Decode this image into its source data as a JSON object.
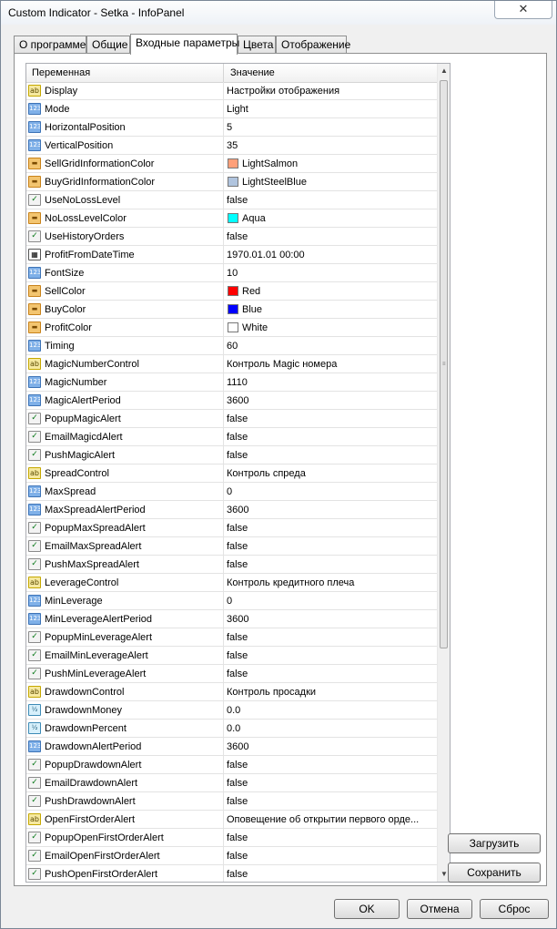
{
  "window": {
    "title": "Custom Indicator - Setka - InfoPanel",
    "close_glyph": "✕"
  },
  "tabs": [
    {
      "label": "О программе"
    },
    {
      "label": "Общие"
    },
    {
      "label": "Входные параметры"
    },
    {
      "label": "Цвета"
    },
    {
      "label": "Отображение"
    }
  ],
  "grid": {
    "col_variable": "Переменная",
    "col_value": "Значение",
    "rows": [
      {
        "type": "ab",
        "icon_text": "ab",
        "name": "Display",
        "value": "Настройки отображения"
      },
      {
        "type": "num",
        "icon_text": "123",
        "name": "Mode",
        "value": "Light"
      },
      {
        "type": "num",
        "icon_text": "123",
        "name": "HorizontalPosition",
        "value": "5"
      },
      {
        "type": "num",
        "icon_text": "123",
        "name": "VerticalPosition",
        "value": "35"
      },
      {
        "type": "color",
        "icon_text": "▬",
        "name": "SellGridInformationColor",
        "value": "LightSalmon",
        "swatch": "#ffa07a"
      },
      {
        "type": "color",
        "icon_text": "▬",
        "name": "BuyGridInformationColor",
        "value": "LightSteelBlue",
        "swatch": "#b0c4de"
      },
      {
        "type": "bool",
        "icon_text": "✓",
        "name": "UseNoLossLevel",
        "value": "false"
      },
      {
        "type": "color",
        "icon_text": "▬",
        "name": "NoLossLevelColor",
        "value": "Aqua",
        "swatch": "#00ffff"
      },
      {
        "type": "bool",
        "icon_text": "✓",
        "name": "UseHistoryOrders",
        "value": "false"
      },
      {
        "type": "dt",
        "icon_text": "▦",
        "name": "ProfitFromDateTime",
        "value": "1970.01.01 00:00"
      },
      {
        "type": "num",
        "icon_text": "123",
        "name": "FontSize",
        "value": "10"
      },
      {
        "type": "color",
        "icon_text": "▬",
        "name": "SellColor",
        "value": "Red",
        "swatch": "#ff0000"
      },
      {
        "type": "color",
        "icon_text": "▬",
        "name": "BuyColor",
        "value": "Blue",
        "swatch": "#0000ff"
      },
      {
        "type": "color",
        "icon_text": "▬",
        "name": "ProfitColor",
        "value": "White",
        "swatch": "#ffffff"
      },
      {
        "type": "num",
        "icon_text": "123",
        "name": "Timing",
        "value": "60"
      },
      {
        "type": "ab",
        "icon_text": "ab",
        "name": "MagicNumberControl",
        "value": "Контроль Magic номера"
      },
      {
        "type": "num",
        "icon_text": "123",
        "name": "MagicNumber",
        "value": "1110"
      },
      {
        "type": "num",
        "icon_text": "123",
        "name": "MagicAlertPeriod",
        "value": "3600"
      },
      {
        "type": "bool",
        "icon_text": "✓",
        "name": "PopupMagicAlert",
        "value": "false"
      },
      {
        "type": "bool",
        "icon_text": "✓",
        "name": "EmailMagicdAlert",
        "value": "false"
      },
      {
        "type": "bool",
        "icon_text": "✓",
        "name": "PushMagicAlert",
        "value": "false"
      },
      {
        "type": "ab",
        "icon_text": "ab",
        "name": "SpreadControl",
        "value": "Контроль спреда"
      },
      {
        "type": "num",
        "icon_text": "123",
        "name": "MaxSpread",
        "value": "0"
      },
      {
        "type": "num",
        "icon_text": "123",
        "name": "MaxSpreadAlertPeriod",
        "value": "3600"
      },
      {
        "type": "bool",
        "icon_text": "✓",
        "name": "PopupMaxSpreadAlert",
        "value": "false"
      },
      {
        "type": "bool",
        "icon_text": "✓",
        "name": "EmailMaxSpreadAlert",
        "value": "false"
      },
      {
        "type": "bool",
        "icon_text": "✓",
        "name": "PushMaxSpreadAlert",
        "value": "false"
      },
      {
        "type": "ab",
        "icon_text": "ab",
        "name": "LeverageControl",
        "value": "Контроль кредитного плеча"
      },
      {
        "type": "num",
        "icon_text": "123",
        "name": "MinLeverage",
        "value": "0"
      },
      {
        "type": "num",
        "icon_text": "123",
        "name": "MinLeverageAlertPeriod",
        "value": "3600"
      },
      {
        "type": "bool",
        "icon_text": "✓",
        "name": "PopupMinLeverageAlert",
        "value": "false"
      },
      {
        "type": "bool",
        "icon_text": "✓",
        "name": "EmailMinLeverageAlert",
        "value": "false"
      },
      {
        "type": "bool",
        "icon_text": "✓",
        "name": "PushMinLeverageAlert",
        "value": "false"
      },
      {
        "type": "ab",
        "icon_text": "ab",
        "name": "DrawdownControl",
        "value": "Контроль просадки"
      },
      {
        "type": "dbl",
        "icon_text": "½",
        "name": "DrawdownMoney",
        "value": "0.0"
      },
      {
        "type": "dbl",
        "icon_text": "½",
        "name": "DrawdownPercent",
        "value": "0.0"
      },
      {
        "type": "num",
        "icon_text": "123",
        "name": "DrawdownAlertPeriod",
        "value": "3600"
      },
      {
        "type": "bool",
        "icon_text": "✓",
        "name": "PopupDrawdownAlert",
        "value": "false"
      },
      {
        "type": "bool",
        "icon_text": "✓",
        "name": "EmailDrawdownAlert",
        "value": "false"
      },
      {
        "type": "bool",
        "icon_text": "✓",
        "name": "PushDrawdownAlert",
        "value": "false"
      },
      {
        "type": "ab",
        "icon_text": "ab",
        "name": "OpenFirstOrderAlert",
        "value": "Оповещение об открытии первого орде..."
      },
      {
        "type": "bool",
        "icon_text": "✓",
        "name": "PopupOpenFirstOrderAlert",
        "value": "false"
      },
      {
        "type": "bool",
        "icon_text": "✓",
        "name": "EmailOpenFirstOrderAlert",
        "value": "false"
      },
      {
        "type": "bool",
        "icon_text": "✓",
        "name": "PushOpenFirstOrderAlert",
        "value": "false"
      }
    ]
  },
  "side_buttons": {
    "load": "Загрузить",
    "save": "Сохранить"
  },
  "footer": {
    "ok": "OK",
    "cancel": "Отмена",
    "reset": "Сброс"
  },
  "scroll": {
    "up": "▲",
    "down": "▼",
    "grip": "≡"
  }
}
